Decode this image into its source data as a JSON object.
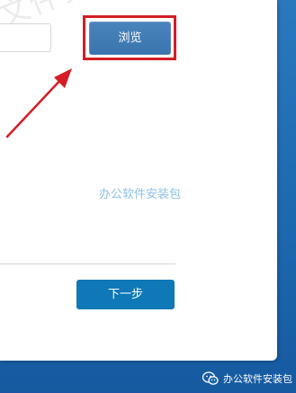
{
  "dialog": {
    "browse_button_label": "浏览",
    "next_button_label": "下一步",
    "path_value": ""
  },
  "watermarks": {
    "top_left": "文件安",
    "center": "办公软件安装包",
    "footer": "办公软件安装包"
  },
  "icons": {
    "footer_icon": "wechat-icon",
    "annotation": "red-arrow"
  },
  "colors": {
    "accent_blue": "#0f78b7",
    "browse_button": "#3f79b3",
    "highlight_red": "#d41d25",
    "background_blue": "#1d69b0"
  }
}
